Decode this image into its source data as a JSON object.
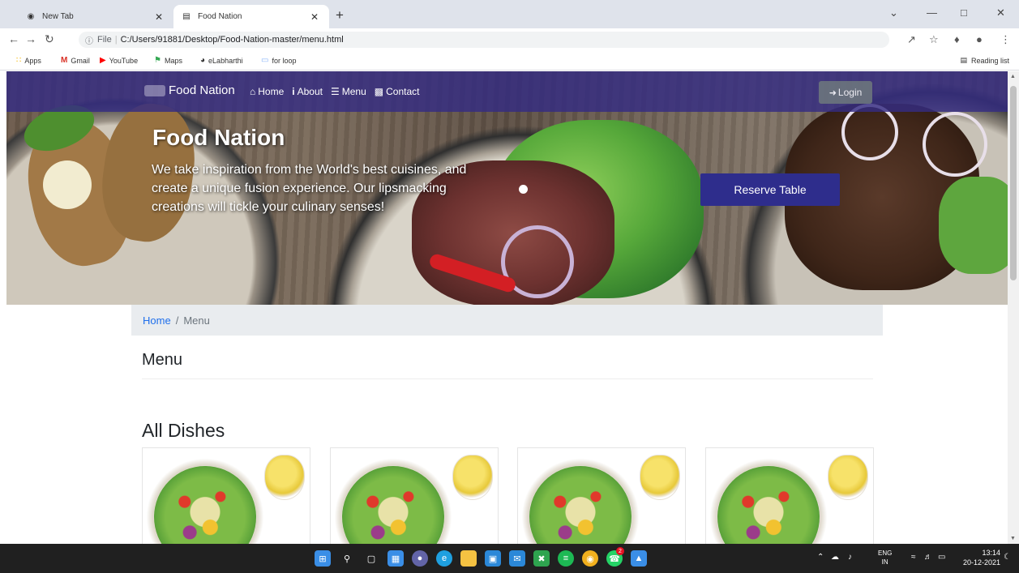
{
  "browser": {
    "tabs": [
      {
        "title": "New Tab",
        "icon": "new-tab-icon"
      },
      {
        "title": "Food Nation",
        "icon": "site-favicon"
      }
    ],
    "address": {
      "scheme": "File",
      "url": "C:/Users/91881/Desktop/Food-Nation-master/menu.html"
    },
    "bookmarks": [
      {
        "label": "Apps",
        "icon": "apps-grid-icon",
        "color": "#f4b400"
      },
      {
        "label": "Gmail",
        "icon": "gmail-icon",
        "color": "#d93025"
      },
      {
        "label": "YouTube",
        "icon": "youtube-icon",
        "color": "#ff0000"
      },
      {
        "label": "Maps",
        "icon": "maps-icon",
        "color": "#34a853"
      },
      {
        "label": "eLabharthi",
        "icon": "globe-icon",
        "color": "#333333"
      },
      {
        "label": "for loop",
        "icon": "page-icon",
        "color": "#8ab4f8"
      }
    ],
    "reading_list": "Reading list"
  },
  "site": {
    "brand": "Food Nation",
    "nav": [
      {
        "label": "Home",
        "icon": "home-icon"
      },
      {
        "label": "About",
        "icon": "info-icon"
      },
      {
        "label": "Menu",
        "icon": "list-icon"
      },
      {
        "label": "Contact",
        "icon": "contact-card-icon"
      }
    ],
    "login": "Login",
    "nav_color": "#342c82"
  },
  "hero": {
    "title": "Food Nation",
    "text": "We take inspiration from the World's best cuisines, and create a unique fusion experience. Our lipsmacking creations will tickle your culinary senses!",
    "cta": "Reserve Table",
    "cta_color": "#2e2d8c"
  },
  "breadcrumb": {
    "home": "Home",
    "separator": "/",
    "current": "Menu"
  },
  "page": {
    "heading": "Menu",
    "section_heading": "All Dishes"
  },
  "dishes": [
    {
      "image": "salad-bowl-with-sauce"
    },
    {
      "image": "salad-bowl-with-sauce"
    },
    {
      "image": "salad-bowl-with-sauce"
    },
    {
      "image": "salad-bowl-with-sauce"
    }
  ],
  "taskbar": {
    "apps": [
      {
        "name": "windows-start-icon",
        "color": "#3a8ee6"
      },
      {
        "name": "search-icon",
        "color": "#ffffff"
      },
      {
        "name": "task-view-icon",
        "color": "#ffffff"
      },
      {
        "name": "widgets-icon",
        "color": "#3a8ee6"
      },
      {
        "name": "teams-chat-icon",
        "color": "#6264a7"
      },
      {
        "name": "edge-icon",
        "color": "#1fa0e0"
      },
      {
        "name": "file-explorer-icon",
        "color": "#f5c242"
      },
      {
        "name": "store-icon",
        "color": "#2b88d8"
      },
      {
        "name": "mail-icon",
        "color": "#2b88d8"
      },
      {
        "name": "xbox-icon",
        "color": "#2ea44f"
      },
      {
        "name": "spotify-icon",
        "color": "#1db954"
      },
      {
        "name": "chrome-icon",
        "color": "#f2b01e"
      },
      {
        "name": "whatsapp-icon",
        "color": "#25d366"
      },
      {
        "name": "photos-icon",
        "color": "#3a8ee6"
      }
    ],
    "whatsapp_badge": "2",
    "lang_top": "ENG",
    "lang_bottom": "IN",
    "time": "13:14",
    "date": "20-12-2021"
  }
}
